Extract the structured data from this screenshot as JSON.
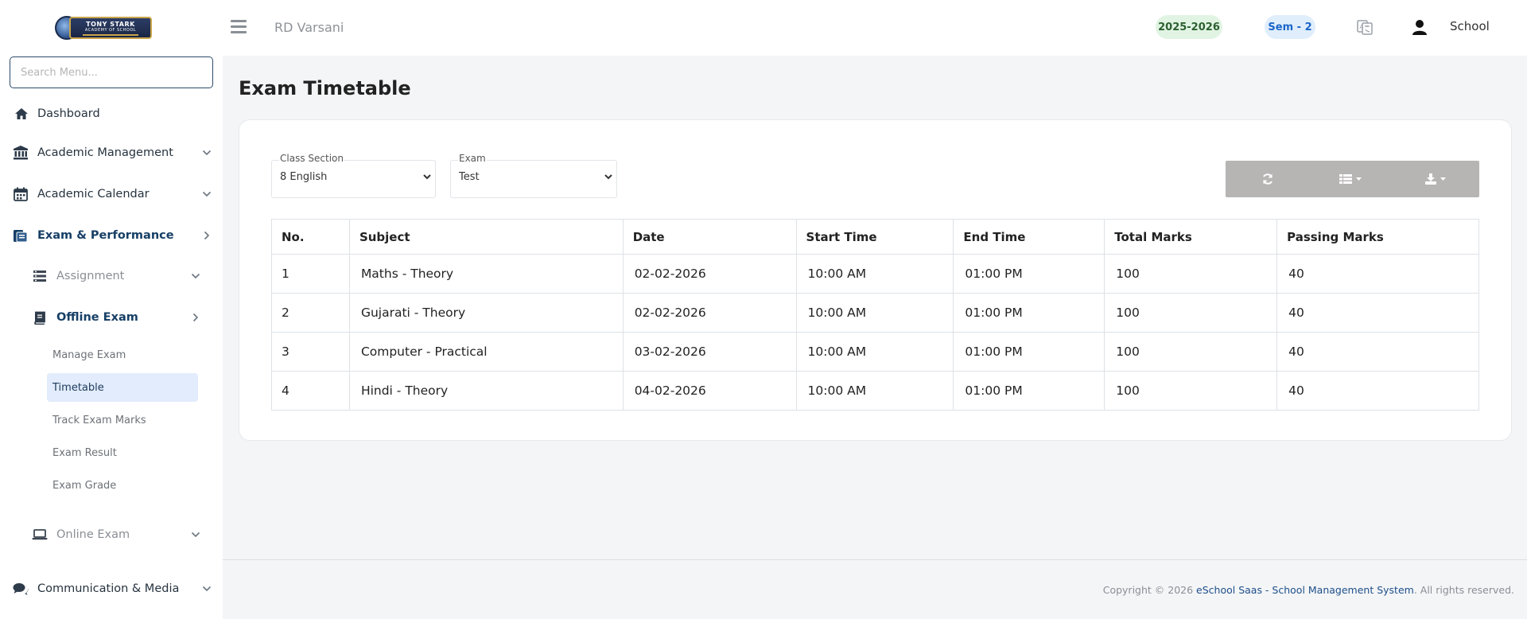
{
  "logo": {
    "line1": "TONY STARK",
    "line2": "ACADEMY OF SCHOOL"
  },
  "search": {
    "placeholder": "Search Menu..."
  },
  "sidebar": {
    "dashboard": "Dashboard",
    "academic_management": "Academic Management",
    "academic_calendar": "Academic Calendar",
    "exam_performance": "Exam & Performance",
    "assignment": "Assignment",
    "offline_exam": "Offline Exam",
    "offline_sub": [
      "Manage Exam",
      "Timetable",
      "Track Exam Marks",
      "Exam Result",
      "Exam Grade"
    ],
    "online_exam": "Online Exam",
    "communication_media": "Communication & Media"
  },
  "topbar": {
    "school_name": "RD Varsani",
    "session": "2025-2026",
    "semester": "Sem - 2",
    "user_label": "School"
  },
  "page": {
    "title": "Exam Timetable"
  },
  "filters": {
    "class_section_label": "Class Section",
    "class_section_value": "8 English",
    "exam_label": "Exam",
    "exam_value": "Test"
  },
  "table": {
    "headers": [
      "No.",
      "Subject",
      "Date",
      "Start Time",
      "End Time",
      "Total Marks",
      "Passing Marks"
    ],
    "rows": [
      [
        "1",
        "Maths - Theory",
        "02-02-2026",
        "10:00 AM",
        "01:00 PM",
        "100",
        "40"
      ],
      [
        "2",
        "Gujarati - Theory",
        "02-02-2026",
        "10:00 AM",
        "01:00 PM",
        "100",
        "40"
      ],
      [
        "3",
        "Computer - Practical",
        "03-02-2026",
        "10:00 AM",
        "01:00 PM",
        "100",
        "40"
      ],
      [
        "4",
        "Hindi - Theory",
        "04-02-2026",
        "10:00 AM",
        "01:00 PM",
        "100",
        "40"
      ]
    ]
  },
  "footer": {
    "prefix": "Copyright © 2026 ",
    "link": "eSchool Saas - School Management System",
    "suffix": ". All rights reserved."
  },
  "colors": {
    "accent": "#173f66",
    "active_bg": "#e2ecfc",
    "session_bg": "#e1f4e3",
    "sem_bg": "#e0eefc",
    "toolbar": "#b7b4b4"
  }
}
